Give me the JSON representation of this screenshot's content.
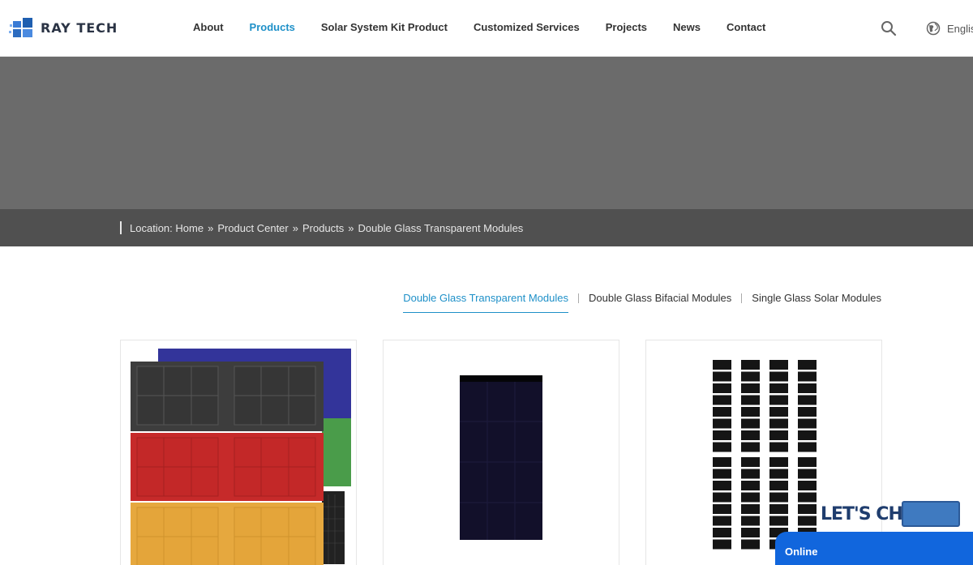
{
  "brand": {
    "name": "RAY TECH"
  },
  "nav": {
    "items": [
      {
        "label": "About",
        "active": false
      },
      {
        "label": "Products",
        "active": true
      },
      {
        "label": "Solar System Kit Product",
        "active": false
      },
      {
        "label": "Customized Services",
        "active": false
      },
      {
        "label": "Projects",
        "active": false
      },
      {
        "label": "News",
        "active": false
      },
      {
        "label": "Contact",
        "active": false
      }
    ],
    "search_icon": "search-icon",
    "language": "Englis"
  },
  "breadcrumb": {
    "prefix": "Location:",
    "items": [
      "Home",
      "Product Center",
      "Products",
      "Double Glass Transparent Modules"
    ],
    "separator": "»"
  },
  "tabs": [
    {
      "label": "Double Glass Transparent Modules",
      "active": true
    },
    {
      "label": "Double Glass Bifacial Modules",
      "active": false
    },
    {
      "label": "Single Glass Solar Modules",
      "active": false
    }
  ],
  "products": [
    {
      "image": "colored-solar-panels"
    },
    {
      "image": "black-transparent-solar-panel"
    },
    {
      "image": "bifacial-cell-strip-panel"
    }
  ],
  "chat": {
    "banner": "LET'S CHAT",
    "status": "Online"
  },
  "colors": {
    "accent": "#1e90c8",
    "banner": "#6b6b6b",
    "crumbbar": "#505050",
    "chat": "#1166dd"
  }
}
